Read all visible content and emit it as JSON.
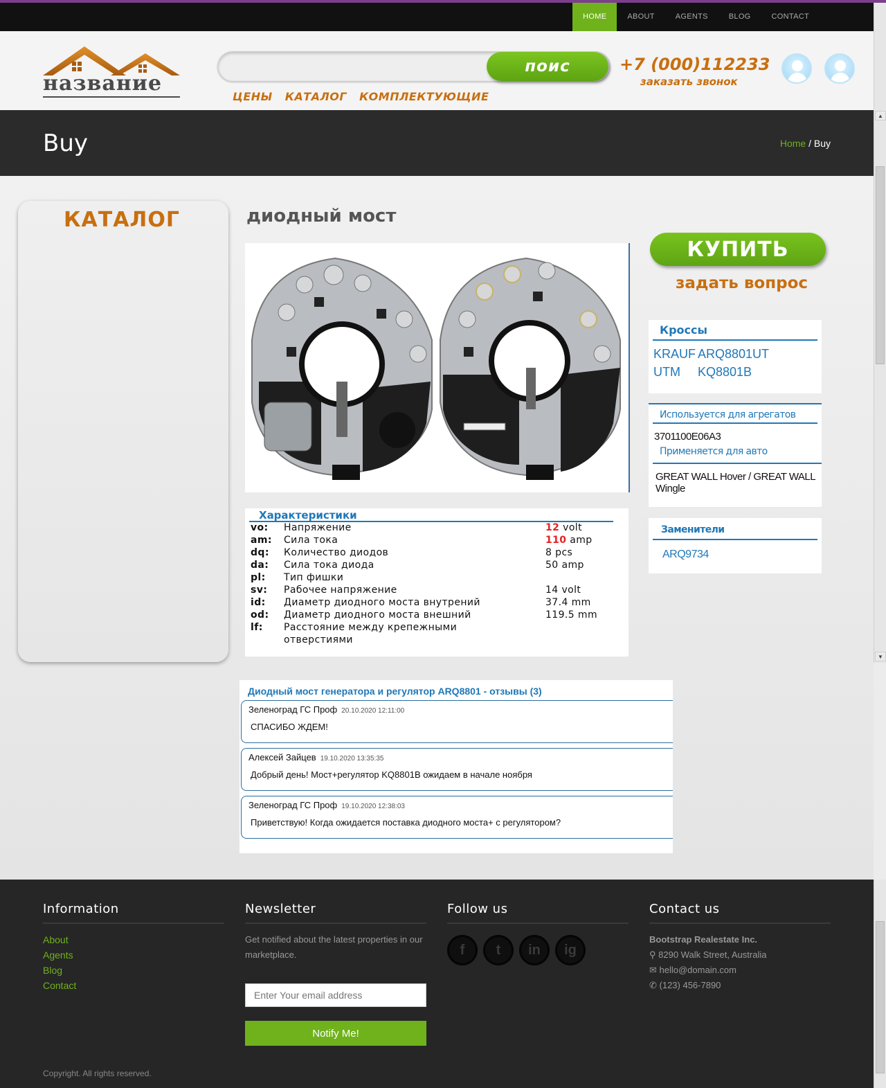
{
  "topnav": {
    "items": [
      "HOME",
      "ABOUT",
      "AGENTS",
      "BLOG",
      "CONTACT"
    ]
  },
  "header": {
    "logo_text": "название",
    "search_placeholder": "",
    "search_button": "поис",
    "menu": [
      "ЦЕНЫ",
      "КАТАЛОГ",
      "КОМПЛЕКТУЮЩИЕ"
    ],
    "phone": "+7 (000)112233",
    "callback": "заказать звонок"
  },
  "banner": {
    "title": "Buy",
    "breadcrumb_home": "Home",
    "breadcrumb_sep": " / ",
    "breadcrumb_current": "Buy"
  },
  "catalog": {
    "title": "КАТАЛОГ"
  },
  "product": {
    "title": "диодный мост",
    "specs_title": "Характеристики",
    "specs": [
      {
        "code": "vo:",
        "name": "Напряжение",
        "value_num": "12",
        "value_unit": " volt",
        "highlight": true
      },
      {
        "code": "am:",
        "name": "Сила тока",
        "value_num": "110",
        "value_unit": " amp",
        "highlight": true
      },
      {
        "code": "dq:",
        "name": "Количество диодов",
        "value_num": "8 pcs",
        "value_unit": "",
        "highlight": false
      },
      {
        "code": "da:",
        "name": "Сила тока диода",
        "value_num": "50 amp",
        "value_unit": "",
        "highlight": false
      },
      {
        "code": "pl:",
        "name": "Тип фишки",
        "value_num": "",
        "value_unit": "",
        "highlight": false
      },
      {
        "code": "sv:",
        "name": "Рабочее напряжение",
        "value_num": "14 volt",
        "value_unit": "",
        "highlight": false
      },
      {
        "code": "id:",
        "name": "Диаметр диодного моста внутрений",
        "value_num": "37.4 mm",
        "value_unit": "",
        "highlight": false
      },
      {
        "code": "od:",
        "name": "Диаметр диодного моста внешний",
        "value_num": "119.5 mm",
        "value_unit": "",
        "highlight": false
      },
      {
        "code": "lf:",
        "name": "Расстояние между крепежными",
        "value_num": "",
        "value_unit": "",
        "highlight": false
      },
      {
        "code": "",
        "name": "отверстиями",
        "value_num": "",
        "value_unit": "",
        "highlight": false
      }
    ]
  },
  "sidebar": {
    "buy_button": "КУПИТЬ",
    "ask": "задать вопрос",
    "crosses_title": "Кроссы",
    "crosses": [
      {
        "brand": "KRAUF",
        "code": "ARQ8801UT"
      },
      {
        "brand": "UTM",
        "code": "KQ8801B"
      }
    ],
    "aggregates_title": "Используется для агрегатов",
    "aggregates_value": "3701100E06A3",
    "cars_title": "Применяется для авто",
    "cars_value": "GREAT WALL Hover / GREAT WALL Wingle",
    "replacements_title": "Заменители",
    "replacements_value": "ARQ9734"
  },
  "reviews": {
    "title": "Диодный мост генератора и регулятор ARQ8801 - отзывы (3)",
    "items": [
      {
        "author": "Зеленоград ГС Проф",
        "date": "20.10.2020 12:11:00",
        "text": "СПАСИБО ЖДЕМ!"
      },
      {
        "author": "Алексей Зайцев",
        "date": "19.10.2020 13:35:35",
        "text": "Добрый день! Мост+регулятор KQ8801B ожидаем в начале ноября"
      },
      {
        "author": "Зеленоград ГС Проф",
        "date": "19.10.2020 12:38:03",
        "text": "Приветствую! Когда ожидается поставка диодного моста+ с регулятором?"
      }
    ]
  },
  "footer": {
    "info_title": "Information",
    "info_links": [
      "About",
      "Agents",
      "Blog",
      "Contact"
    ],
    "newsletter_title": "Newsletter",
    "newsletter_text": "Get notified about the latest properties in our marketplace.",
    "email_placeholder": "Enter Your email address",
    "notify_button": "Notify Me!",
    "follow_title": "Follow us",
    "social": [
      "f",
      "t",
      "in",
      "ig"
    ],
    "contact_title": "Contact us",
    "company": "Bootstrap Realestate Inc.",
    "address": "8290 Walk Street, Australia",
    "email": "hello@domain.com",
    "phone": "(123) 456-7890",
    "copyright": "Copyright. All rights reserved."
  },
  "colors": {
    "accent_green": "#6fb21b",
    "brand_orange": "#c86f10",
    "link_blue": "#1f78b8",
    "dark": "#262626"
  }
}
